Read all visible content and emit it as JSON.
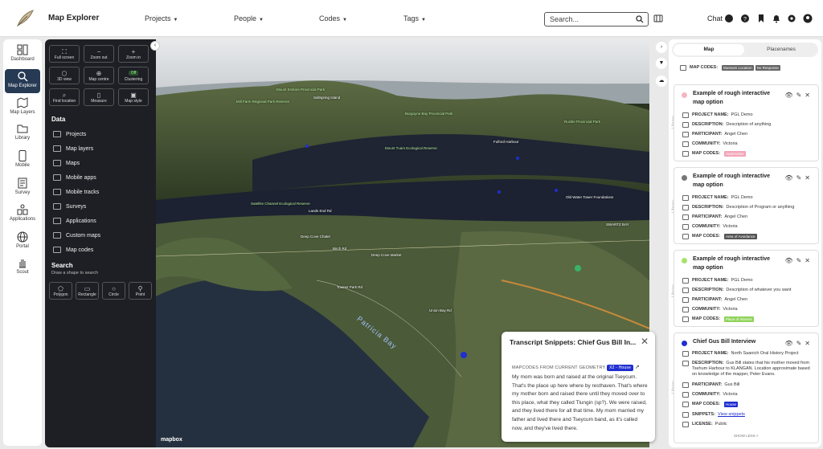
{
  "app": {
    "title": "Map Explorer"
  },
  "topnav": [
    {
      "label": "Projects"
    },
    {
      "label": "People"
    },
    {
      "label": "Codes"
    },
    {
      "label": "Tags"
    }
  ],
  "search": {
    "placeholder": "Search..."
  },
  "chat_label": "Chat",
  "leftnav": [
    {
      "label": "Dashboard",
      "icon": "dashboard-icon"
    },
    {
      "label": "Map Explorer",
      "icon": "map-search-icon",
      "active": true
    },
    {
      "label": "Map Layers",
      "icon": "map-layers-icon"
    },
    {
      "label": "Library",
      "icon": "library-icon"
    },
    {
      "label": "Mobile",
      "icon": "mobile-icon"
    },
    {
      "label": "Survey",
      "icon": "survey-icon"
    },
    {
      "label": "Applications",
      "icon": "applications-icon"
    },
    {
      "label": "Portal",
      "icon": "globe-icon"
    },
    {
      "label": "Scout",
      "icon": "hand-icon"
    }
  ],
  "tools": {
    "buttons": [
      "Full screen",
      "Zoom out",
      "Zoom in",
      "3D view",
      "Map centre",
      "Clustering",
      "Find location",
      "Measure",
      "Map style"
    ],
    "clustering_badge": "Off",
    "data_title": "Data",
    "data_items": [
      "Projects",
      "Map layers",
      "Maps",
      "Mobile apps",
      "Mobile tracks",
      "Surveys",
      "Applications",
      "Custom maps",
      "Map codes"
    ],
    "search_title": "Search",
    "search_sub": "Draw a shape to search",
    "shapes": [
      "Polygon",
      "Rectangle",
      "Circle",
      "Point"
    ]
  },
  "map": {
    "attribution": "mapbox",
    "labels": [
      {
        "t": "Saltspring Island"
      },
      {
        "t": "Mill Farm Regional Park Reserve"
      },
      {
        "t": "Mount Erskine Provincial Park"
      },
      {
        "t": "Burgoyne Bay Provincial Park"
      },
      {
        "t": "Mount Tuam Ecological Reserve"
      },
      {
        "t": "Satellite Channel Ecological Reserve"
      },
      {
        "t": "Lands End Rd"
      },
      {
        "t": "Deep Cove Chalet"
      },
      {
        "t": "Deep Cove Market"
      },
      {
        "t": "Birch Rd"
      },
      {
        "t": "Towner Park Rd"
      },
      {
        "t": "Union Bay Rd"
      },
      {
        "t": "Fulford Harbour"
      },
      {
        "t": "Old Water Tower Foundations"
      },
      {
        "t": "SWARTZ BAY"
      },
      {
        "t": "Ruckle Provincial Park"
      }
    ],
    "bay_label": "Patricia Bay"
  },
  "snippet": {
    "title": "Transcript Snippets: Chief Gus Bill In...",
    "sub_label": "MAPCODES FROM CURRENT GEOMETRY",
    "badge": "X2 - House",
    "text": "My mom was born and raised at the original Tseycum. That's the place up here where by resthaven. That's where my mother born and raised there until they moved over to this place, what they called Tlungin (sp?). We were raised, and they lived there for all that time. My mom married my father and lived there and Tseycum band, as it's called now, and they've lived there."
  },
  "rpanel": {
    "tab_map": "Map",
    "tab_placenames": "Placenames",
    "library_label": "Library",
    "first_codes_label": "MAP CODES:",
    "first_codes": [
      "Museum Location",
      "No Response"
    ],
    "cards": [
      {
        "title": "Example of rough interactive map option",
        "color": "#f4b6c2",
        "project": "PGL Demo",
        "description": "Description of anything",
        "participant": "Angel Chen",
        "community": "Victoria",
        "code": "Automotive",
        "code_color": "#f2a5b8"
      },
      {
        "title": "Example of rough interactive map option",
        "color": "#777777",
        "project": "PGL Demo",
        "description": "Description of Program or anything",
        "participant": "Angel Chen",
        "community": "Victoria",
        "code": "Area of Avoidance",
        "code_color": "#555555"
      },
      {
        "title": "Example of rough interactive map option",
        "color": "#a6e26e",
        "project": "PGL Demo",
        "description": "Description of whatever you want",
        "participant": "Angel Chen",
        "community": "Victoria",
        "code": "Place of Interest",
        "code_color": "#8fd35a"
      },
      {
        "title": "Chief Gus Bill Interview",
        "color": "#1f2fd1",
        "project": "North Saanich Oral History Project",
        "description": "Gus Bill states that his mother moved from Tsehum Harbour to KLANGAN. Location approximate based on knowledge of the mapper, Peter Evans.",
        "participant": "Gus Bill",
        "community": "Victoria",
        "code": "House",
        "code_color": "#1f2fd1",
        "snippets": "View snippets",
        "license": "Public",
        "show_less": "SHOW LESS"
      }
    ],
    "labels": {
      "project": "PROJECT NAME:",
      "description": "DESCRIPTION:",
      "participant": "PARTICIPANT:",
      "community": "COMMUNITY:",
      "codes": "MAP CODES:",
      "snippets": "SNIPPETS:",
      "license": "LICENSE:"
    }
  }
}
